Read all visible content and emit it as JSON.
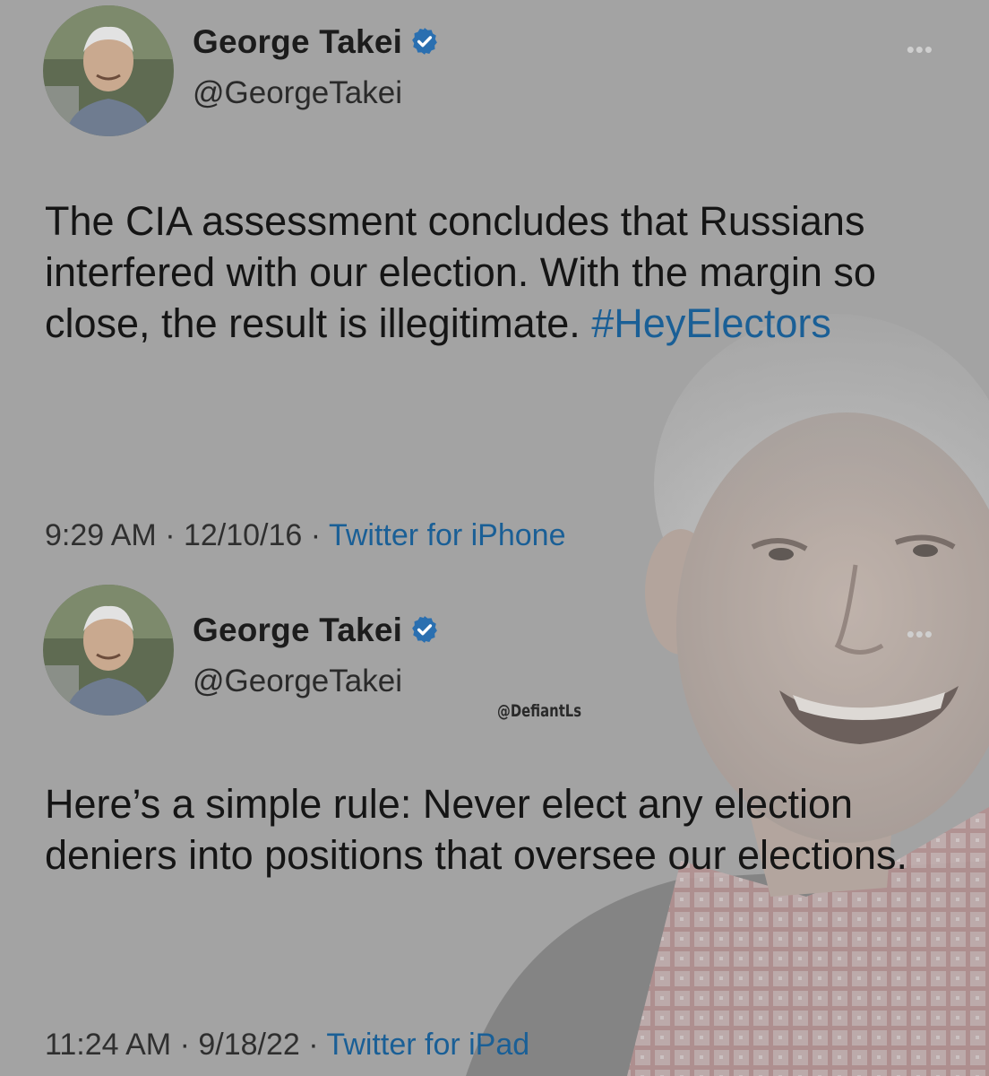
{
  "tweets": [
    {
      "display_name": "George Takei",
      "handle": "@GeorgeTakei",
      "text": "The CIA assessment concludes that Russians interfered with our election. With the margin so close, the result is illegitimate.",
      "hashtag": "#HeyElectors",
      "time": "9:29 AM",
      "date": "12/10/16",
      "source": "Twitter for iPhone",
      "verified": true,
      "more_icon": "more-horizontal-icon"
    },
    {
      "display_name": "George Takei",
      "handle": "@GeorgeTakei",
      "text": "Here’s a simple rule: Never elect any election deniers into positions that oversee our elections.",
      "time": "11:24 AM",
      "date": "9/18/22",
      "source": "Twitter for iPad",
      "verified": true,
      "more_icon": "more-horizontal-icon"
    }
  ],
  "separator": " · ",
  "watermark": "@DefiantLs",
  "colors": {
    "background": "#a3a3a3",
    "text": "#151515",
    "link": "#1a5f96",
    "verified": "#2a6fb0"
  }
}
